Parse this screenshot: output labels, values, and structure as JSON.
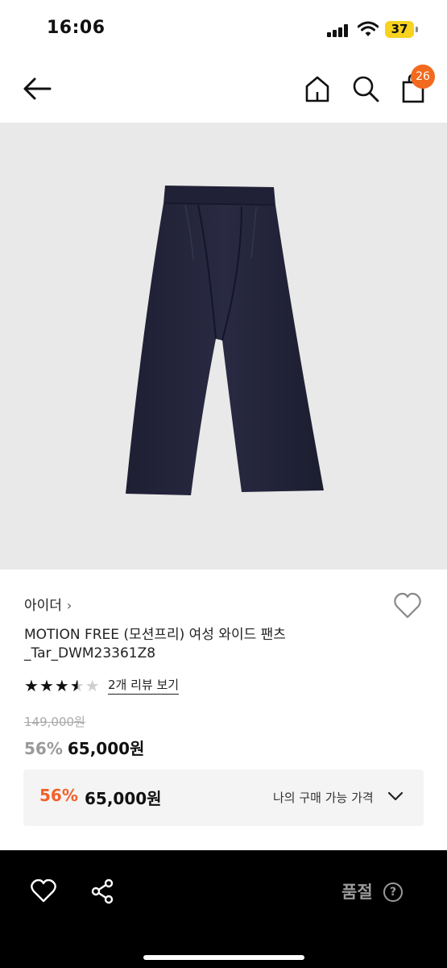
{
  "status_bar": {
    "time": "16:06",
    "battery": "37"
  },
  "nav": {
    "cart_badge": "26"
  },
  "product": {
    "brand": "아이더",
    "brand_chevron": "›",
    "title_line1": "MOTION FREE (모션프리) 여성 와이드 팬츠",
    "title_line2": "_Tar_DWM23361Z8",
    "rating": 3.5,
    "rating_max": 5,
    "review_link": "2개 리뷰 보기",
    "original_price": "149,000원",
    "discount": "56%",
    "price": "65,000원"
  },
  "buy_box": {
    "discount": "56%",
    "price": "65,000원",
    "label": "나의 구매 가능 가격"
  },
  "bottom_bar": {
    "status_label": "품절",
    "help_glyph": "?"
  },
  "icons": [
    "back-arrow-icon",
    "home-icon",
    "search-icon",
    "shopping-bag-icon",
    "heart-icon",
    "share-icon",
    "chevron-down-icon",
    "help-icon"
  ],
  "colors": {
    "accent": "#f26a1e",
    "discount": "#f2602a",
    "image_bg": "#e9e9e9",
    "bottom_bar": "#000000"
  }
}
